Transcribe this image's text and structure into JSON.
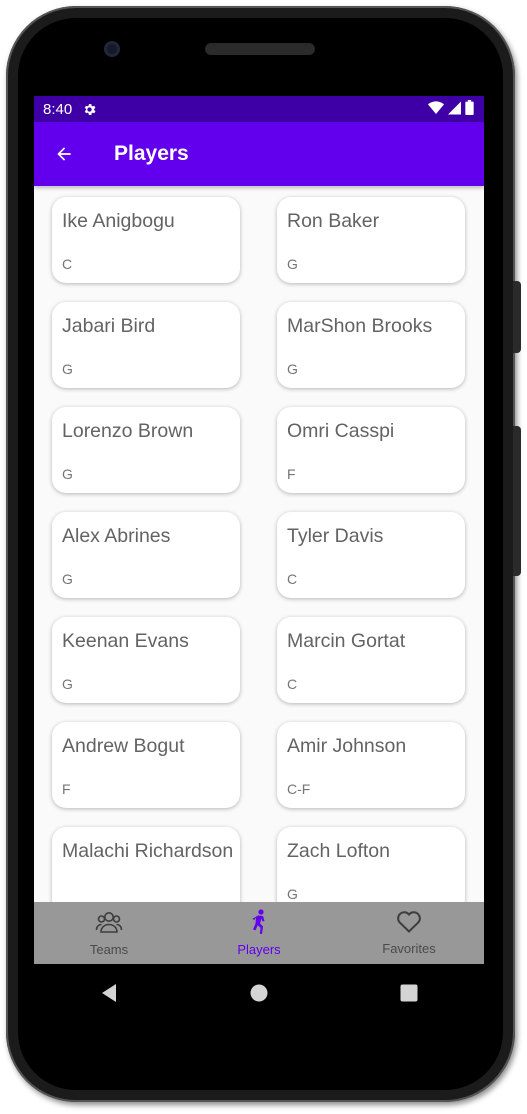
{
  "status_bar": {
    "time": "8:40"
  },
  "app_bar": {
    "title": "Players"
  },
  "players": [
    {
      "name": "Ike Anigbogu",
      "position": "C"
    },
    {
      "name": "Ron Baker",
      "position": "G"
    },
    {
      "name": "Jabari Bird",
      "position": "G"
    },
    {
      "name": "MarShon Brooks",
      "position": "G"
    },
    {
      "name": "Lorenzo Brown",
      "position": "G"
    },
    {
      "name": "Omri Casspi",
      "position": "F"
    },
    {
      "name": "Alex Abrines",
      "position": "G"
    },
    {
      "name": "Tyler Davis",
      "position": "C"
    },
    {
      "name": "Keenan Evans",
      "position": "G"
    },
    {
      "name": "Marcin Gortat",
      "position": "C"
    },
    {
      "name": "Andrew Bogut",
      "position": "F"
    },
    {
      "name": "Amir Johnson",
      "position": "C-F"
    },
    {
      "name": "Malachi Richardson",
      "position": ""
    },
    {
      "name": "Zach Lofton",
      "position": "G"
    }
  ],
  "bottom_nav": {
    "teams": {
      "label": "Teams",
      "icon": "team-icon"
    },
    "players": {
      "label": "Players",
      "icon": "player-icon"
    },
    "favorites": {
      "label": "Favorites",
      "icon": "heart-icon"
    }
  },
  "colors": {
    "primary": "#6200ee",
    "primary_dark": "#3e00a6",
    "nav_background": "#989898"
  }
}
